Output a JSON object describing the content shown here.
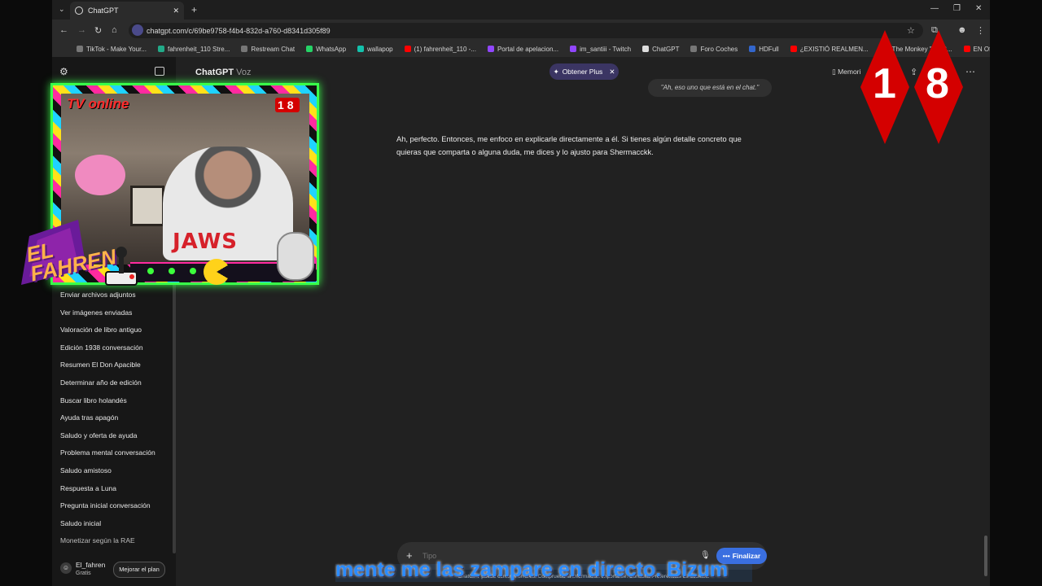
{
  "browser": {
    "tab_title": "ChatGPT",
    "url": "chatgpt.com/c/69be9758-f4b4-832d-a760-d8341d305f89",
    "bookmarks": [
      "TikTok - Make Your...",
      "fahrenheit_110 Stre...",
      "Restream Chat",
      "WhatsApp",
      "wallapop",
      "(1) fahrenheit_110 -...",
      "Portal de apelacion...",
      "im_santiii - Twitch",
      "ChatGPT",
      "Foro Coches",
      "HDFull",
      "¿EXISTIÓ REALMEN...",
      "\"The Monkey \" (202...",
      "EN Official U..."
    ]
  },
  "header": {
    "model_name": "ChatGPT",
    "model_variant": "Voz",
    "plus_label": "Obtener Plus",
    "memory_label": "Memori"
  },
  "sidebar": {
    "history": [
      "Enviar archivos adjuntos",
      "Ver imágenes enviadas",
      "Valoración de libro antiguo",
      "Edición 1938 conversación",
      "Resumen El Don Apacible",
      "Determinar año de edición",
      "Buscar libro holandés",
      "Ayuda tras apagón",
      "Saludo y oferta de ayuda",
      "Problema mental conversación",
      "Saludo amistoso",
      "Respuesta a Luna",
      "Pregunta inicial conversación",
      "Saludo inicial",
      "Monetizar según la RAE"
    ],
    "user_name": "El_fahren",
    "user_plan": "Gratis",
    "upgrade_label": "Mejorar el plan"
  },
  "chat": {
    "user_message": "\"Ah, eso uno que está en el chat.\"",
    "assistant_message": "Ah, perfecto. Entonces, me enfoco en explicarle directamente a él. Si tienes algún detalle concreto que quieras que comparta o alguna duda, me dices y lo ajusto para Shermacckk."
  },
  "composer": {
    "placeholder": "Tipo",
    "finalize_label": "Finalizar",
    "disclaimer": "ChatGPT puede cometer errores. Comprueba la información importante. Consulta Preferencias de cookies."
  },
  "overlay": {
    "tv_label": "TV online",
    "logo_line1": "EL",
    "logo_line2": "FAHREN",
    "shirt_text": "JAWS",
    "cam_badge": "18",
    "badge_digit_1": "1",
    "badge_digit_2": "8",
    "subtitle": "mente me las zampare en directo. Bizum"
  },
  "colors": {
    "accent_blue": "#3a6fe0",
    "plus_pill": "#3b3563",
    "badge_red": "#d40000",
    "neon_green": "#39ff4a"
  }
}
